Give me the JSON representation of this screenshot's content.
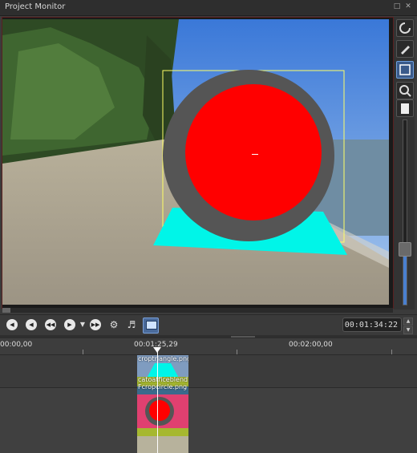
{
  "window": {
    "title": "Project Monitor",
    "float_icon": "float-icon",
    "close_icon": "close-icon"
  },
  "tools": [
    {
      "name": "rotate-tool-icon"
    },
    {
      "name": "pen-tool-icon"
    },
    {
      "name": "fit-frame-tool-icon",
      "active": true
    },
    {
      "name": "zoom-icon"
    },
    {
      "name": "page-icon"
    }
  ],
  "zoom": {
    "level": 0.3
  },
  "transport": {
    "buttons": [
      "rewind-start-icon",
      "rewind-icon",
      "step-back-icon",
      "play-icon",
      "fast-forward-icon"
    ],
    "timecode": "00:01:34:22"
  },
  "ruler": {
    "labels": [
      "00:00,00",
      "00:01:25,29",
      "00:02:00,00"
    ]
  },
  "clips": {
    "track1": {
      "label": "croptriangle.png"
    },
    "track2": {
      "label_top": "catoatficeblend",
      "label_main": "Fcropcircle.png"
    }
  },
  "colors": {
    "accent": "#4a80d0",
    "overlay_frame": "#ffff66",
    "circle": "#ff0000",
    "ring": "#555555",
    "triangle": "#00ffee"
  }
}
